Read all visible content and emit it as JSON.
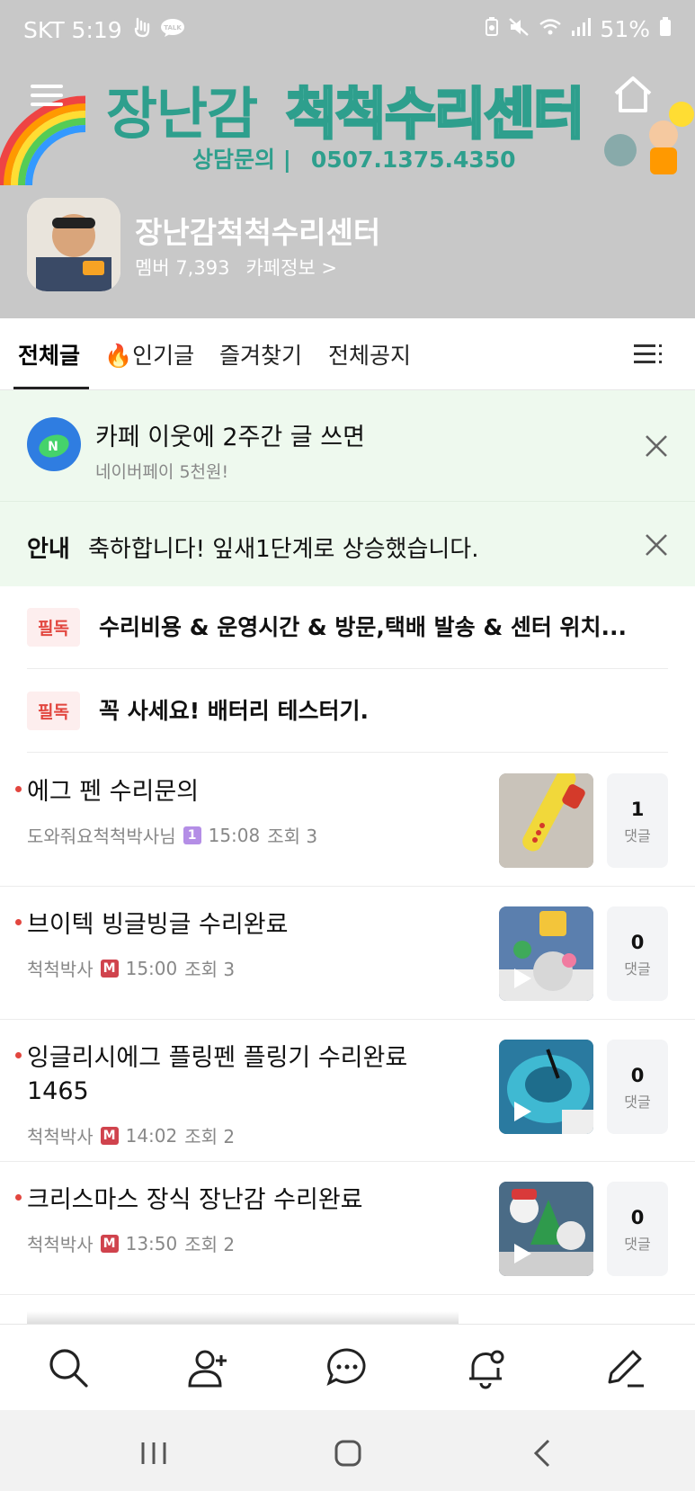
{
  "status_bar": {
    "carrier_time": "SKT 5:19",
    "battery": "51%",
    "icons_left": [
      "gesture-icon",
      "talk-icon"
    ],
    "icons_right": [
      "battery-saver-icon",
      "mute-icon",
      "wifi-icon",
      "signal-icon",
      "battery-icon"
    ]
  },
  "banner": {
    "title_part1": "장난감",
    "title_part2": "척척수리센터",
    "contact_label": "상담문의 |",
    "contact_number": "0507.1375.4350"
  },
  "cafe": {
    "name": "장난감척척수리센터",
    "members": "멤버 7,393",
    "info_link": "카페정보 >"
  },
  "tabs": [
    {
      "label": "전체글",
      "active": true
    },
    {
      "label": "🔥인기글",
      "active": false
    },
    {
      "label": "즐겨찾기",
      "active": false
    },
    {
      "label": "전체공지",
      "active": false
    }
  ],
  "promo": {
    "title": "카페 이웃에 2주간 글 쓰면",
    "subtitle": "네이버페이 5천원!"
  },
  "info_notice": {
    "tag": "안내",
    "text": "축하합니다! 잎새1단계로 상승했습니다."
  },
  "pinned": [
    {
      "badge": "필독",
      "title": "수리비용 & 운영시간 & 방문,택배 발송 & 센터 위치..."
    },
    {
      "badge": "필독",
      "title": "꼭 사세요! 배터리 테스터기."
    }
  ],
  "posts": [
    {
      "title": "에그 펜 수리문의",
      "author": "도와줘요척척박사님",
      "level": "1",
      "time": "15:08",
      "views": "조회 3",
      "comments": "1",
      "comment_label": "댓글",
      "video": false
    },
    {
      "title": "브이텍 빙글빙글 수리완료",
      "author": "척척박사",
      "level": "M",
      "time": "15:00",
      "views": "조회 3",
      "comments": "0",
      "comment_label": "댓글",
      "video": true
    },
    {
      "title": "잉글리시에그 플링펜 플링기 수리완료 1465",
      "author": "척척박사",
      "level": "M",
      "time": "14:02",
      "views": "조회 2",
      "comments": "0",
      "comment_label": "댓글",
      "video": true
    },
    {
      "title": "크리스마스 장식 장난감 수리완료",
      "author": "척척박사",
      "level": "M",
      "time": "13:50",
      "views": "조회 2",
      "comments": "0",
      "comment_label": "댓글",
      "video": true
    }
  ],
  "bottom_nav": [
    "search-icon",
    "add-friend-icon",
    "chat-icon",
    "notification-settings-icon",
    "write-icon"
  ],
  "system_nav": [
    "recent-apps-icon",
    "home-icon",
    "back-icon"
  ],
  "colors": {
    "header_bg": "#c8c8c8",
    "notice_bg": "#eef9ee",
    "badge_red": "#e2463f",
    "brand_teal": "#2e9f8d"
  }
}
